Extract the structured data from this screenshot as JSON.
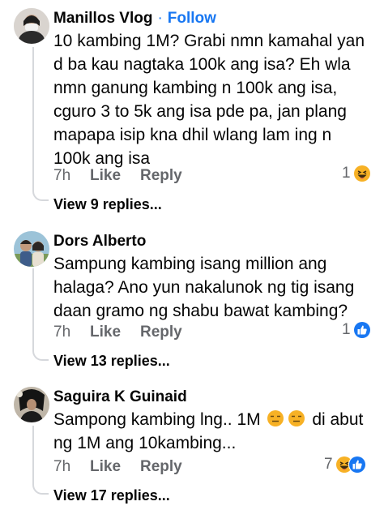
{
  "comments": [
    {
      "author": "Manillos Vlog",
      "dot": "·",
      "follow": "Follow",
      "text": "10 kambing 1M? Grabi nmn kamahal yan d ba kau nagtaka 100k ang isa? Eh wla nmn ganung kambing n 100k ang isa, cguro 3 to 5k ang isa pde pa, jan plang mapapa isip kna dhil wlang lam ing n 100k ang isa",
      "time": "7h",
      "like": "Like",
      "reply": "Reply",
      "reaction_count": "1",
      "reaction_icons": [
        "haha-icon"
      ],
      "view_replies": "View 9 replies..."
    },
    {
      "author": "Dors Alberto",
      "text": "Sampung kambing isang million ang halaga? Ano yun nakalunok ng tig isang daan gramo ng shabu bawat kambing?",
      "time": "7h",
      "like": "Like",
      "reply": "Reply",
      "reaction_count": "1",
      "reaction_icons": [
        "like-icon"
      ],
      "view_replies": "View 13 replies..."
    },
    {
      "author": "Saguira K Guinaid",
      "text_part1": "Sampong kambing lng.. 1M",
      "text_part2": "di abut ng 1M ang 10kambing...",
      "inline_emojis": [
        "expressionless-face-icon",
        "expressionless-face-icon"
      ],
      "time": "7h",
      "like": "Like",
      "reply": "Reply",
      "reaction_count": "7",
      "reaction_icons": [
        "haha-icon",
        "like-icon"
      ],
      "view_replies": "View 17 replies..."
    }
  ],
  "colors": {
    "link_blue": "#1877f2",
    "meta_gray": "#65676b",
    "text": "#050505",
    "thread_line": "#d6d8dc"
  }
}
